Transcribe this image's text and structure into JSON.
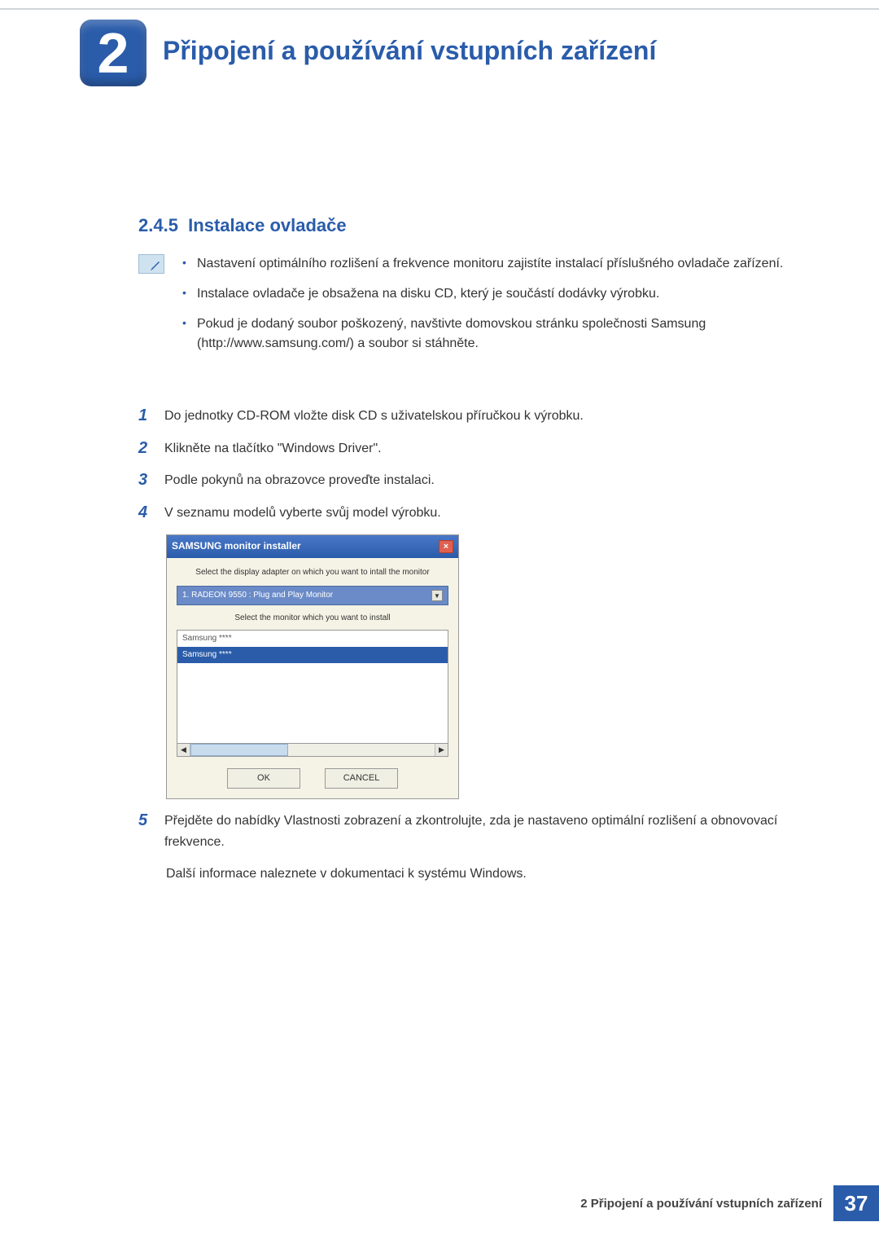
{
  "header": {
    "chapter_number": "2",
    "chapter_title": "Připojení a používání vstupních zařízení"
  },
  "section": {
    "number": "2.4.5",
    "title": "Instalace ovladače"
  },
  "notes": [
    "Nastavení optimálního rozlišení a frekvence monitoru zajistíte instalací příslušného ovladače zařízení.",
    "Instalace ovladače je obsažena na disku CD, který je součástí dodávky výrobku.",
    "Pokud je dodaný soubor poškozený, navštivte domovskou stránku společnosti Samsung (http://www.samsung.com/) a soubor si stáhněte."
  ],
  "steps": [
    {
      "n": "1",
      "text": "Do jednotky CD-ROM vložte disk CD s uživatelskou příručkou k výrobku."
    },
    {
      "n": "2",
      "text": "Klikněte na tlačítko \"Windows Driver\"."
    },
    {
      "n": "3",
      "text": "Podle pokynů na obrazovce proveďte instalaci."
    },
    {
      "n": "4",
      "text": "V seznamu modelů vyberte svůj model výrobku."
    },
    {
      "n": "5",
      "text": "Přejděte do nabídky Vlastnosti zobrazení a zkontrolujte, zda je nastaveno optimální rozlišení a obnovovací frekvence."
    }
  ],
  "step5_extra": "Další informace naleznete v dokumentaci k systému Windows.",
  "installer": {
    "title": "SAMSUNG monitor installer",
    "label_adapter": "Select the display adapter on which you want to intall the monitor",
    "combo_value": "1. RADEON 9550 : Plug and Play Monitor",
    "label_monitor": "Select the monitor which you want to install",
    "list": [
      "Samsung ****",
      "Samsung ****"
    ],
    "ok": "OK",
    "cancel": "CANCEL"
  },
  "footer": {
    "text": "2 Připojení a používání vstupních zařízení",
    "page": "37"
  }
}
